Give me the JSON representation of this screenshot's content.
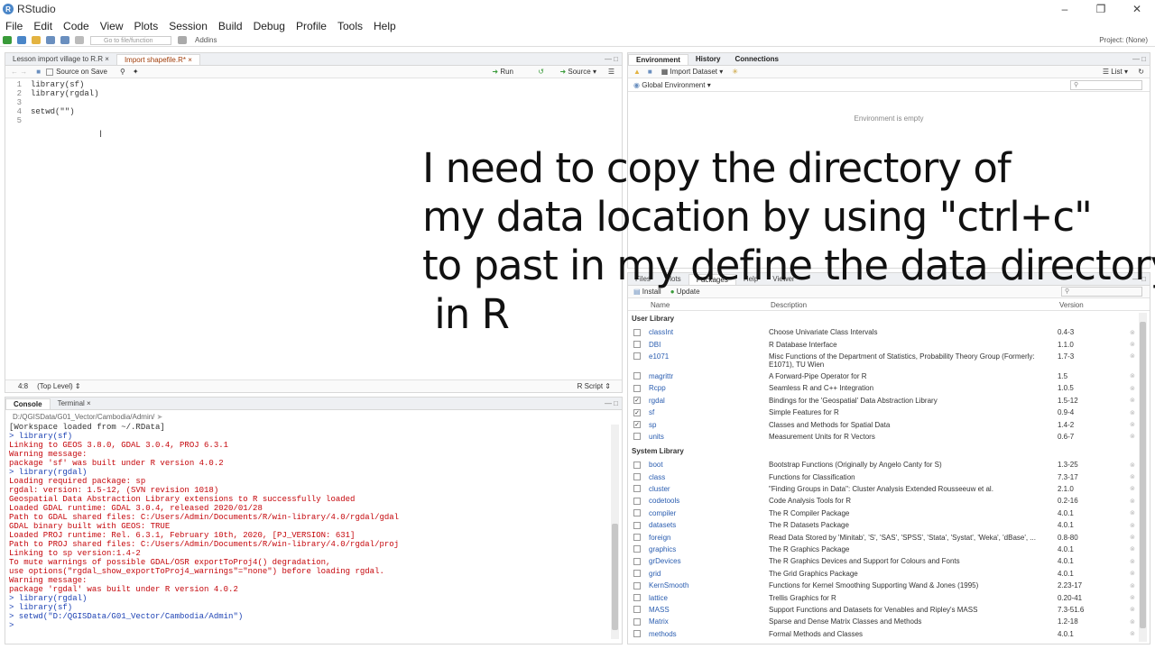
{
  "app": {
    "title": "RStudio",
    "logo": "R"
  },
  "menu": [
    "File",
    "Edit",
    "Code",
    "View",
    "Plots",
    "Session",
    "Build",
    "Debug",
    "Profile",
    "Tools",
    "Help"
  ],
  "toolbar": {
    "goto_placeholder": "Go to file/function",
    "addins": "Addins",
    "project": "Project: (None)"
  },
  "editor": {
    "tabs": [
      {
        "label": "Lesson import village to R.R"
      },
      {
        "label": "Import shapefile.R*"
      }
    ],
    "source_on_save": "Source on Save",
    "run": "Run",
    "source": "Source",
    "lines": [
      {
        "n": "1",
        "text": "library(sf)"
      },
      {
        "n": "2",
        "text": "library(rgdal)"
      },
      {
        "n": "3",
        "text": ""
      },
      {
        "n": "4",
        "text": "setwd(\"\")"
      },
      {
        "n": "5",
        "text": ""
      }
    ],
    "status_pos": "4:8",
    "status_scope": "(Top Level)",
    "status_type": "R Script"
  },
  "environment": {
    "tabs": [
      "Environment",
      "History",
      "Connections"
    ],
    "import_dataset": "Import Dataset",
    "list_view": "List",
    "global_env": "Global Environment",
    "empty_msg": "Environment is empty"
  },
  "console": {
    "tabs": [
      "Console",
      "Terminal"
    ],
    "path": "D:/QGISData/G01_Vector/Cambodia/Admin/",
    "lines": [
      {
        "c": "blk",
        "t": "[Workspace loaded from ~/.RData]"
      },
      {
        "c": "blk",
        "t": ""
      },
      {
        "c": "blue",
        "t": "> library(sf)"
      },
      {
        "c": "red",
        "t": "Linking to GEOS 3.8.0, GDAL 3.0.4, PROJ 6.3.1"
      },
      {
        "c": "red",
        "t": "Warning message:"
      },
      {
        "c": "red",
        "t": "package 'sf' was built under R version 4.0.2"
      },
      {
        "c": "blue",
        "t": "> library(rgdal)"
      },
      {
        "c": "red",
        "t": "Loading required package: sp"
      },
      {
        "c": "red",
        "t": "rgdal: version: 1.5-12, (SVN revision 1018)"
      },
      {
        "c": "red",
        "t": "Geospatial Data Abstraction Library extensions to R successfully loaded"
      },
      {
        "c": "red",
        "t": "Loaded GDAL runtime: GDAL 3.0.4, released 2020/01/28"
      },
      {
        "c": "red",
        "t": "Path to GDAL shared files: C:/Users/Admin/Documents/R/win-library/4.0/rgdal/gdal"
      },
      {
        "c": "red",
        "t": "GDAL binary built with GEOS: TRUE"
      },
      {
        "c": "red",
        "t": "Loaded PROJ runtime: Rel. 6.3.1, February 10th, 2020, [PJ_VERSION: 631]"
      },
      {
        "c": "red",
        "t": "Path to PROJ shared files: C:/Users/Admin/Documents/R/win-library/4.0/rgdal/proj"
      },
      {
        "c": "red",
        "t": "Linking to sp version:1.4-2"
      },
      {
        "c": "red",
        "t": "To mute warnings of possible GDAL/OSR exportToProj4() degradation,"
      },
      {
        "c": "red",
        "t": "use options(\"rgdal_show_exportToProj4_warnings\"=\"none\") before loading rgdal."
      },
      {
        "c": "red",
        "t": "Warning message:"
      },
      {
        "c": "red",
        "t": "package 'rgdal' was built under R version 4.0.2"
      },
      {
        "c": "blue",
        "t": "> library(rgdal)"
      },
      {
        "c": "blue",
        "t": "> library(sf)"
      },
      {
        "c": "blue",
        "t": "> setwd(\"D:/QGISData/G01_Vector/Cambodia/Admin\")"
      },
      {
        "c": "blue",
        "t": "> "
      }
    ]
  },
  "packages": {
    "tabs": [
      "Files",
      "Plots",
      "Packages",
      "Help",
      "Viewer"
    ],
    "install": "Install",
    "update": "Update",
    "headers": {
      "name": "Name",
      "desc": "Description",
      "version": "Version"
    },
    "user_label": "User Library",
    "system_label": "System Library",
    "user": [
      {
        "name": "classInt",
        "desc": "Choose Univariate Class Intervals",
        "ver": "0.4-3",
        "checked": false
      },
      {
        "name": "DBI",
        "desc": "R Database Interface",
        "ver": "1.1.0",
        "checked": false
      },
      {
        "name": "e1071",
        "desc": "Misc Functions of the Department of Statistics, Probability Theory Group (Formerly: E1071), TU Wien",
        "ver": "1.7-3",
        "checked": false
      },
      {
        "name": "magrittr",
        "desc": "A Forward-Pipe Operator for R",
        "ver": "1.5",
        "checked": false
      },
      {
        "name": "Rcpp",
        "desc": "Seamless R and C++ Integration",
        "ver": "1.0.5",
        "checked": false
      },
      {
        "name": "rgdal",
        "desc": "Bindings for the 'Geospatial' Data Abstraction Library",
        "ver": "1.5-12",
        "checked": true
      },
      {
        "name": "sf",
        "desc": "Simple Features for R",
        "ver": "0.9-4",
        "checked": true
      },
      {
        "name": "sp",
        "desc": "Classes and Methods for Spatial Data",
        "ver": "1.4-2",
        "checked": true
      },
      {
        "name": "units",
        "desc": "Measurement Units for R Vectors",
        "ver": "0.6-7",
        "checked": false
      }
    ],
    "system": [
      {
        "name": "boot",
        "desc": "Bootstrap Functions (Originally by Angelo Canty for S)",
        "ver": "1.3-25"
      },
      {
        "name": "class",
        "desc": "Functions for Classification",
        "ver": "7.3-17"
      },
      {
        "name": "cluster",
        "desc": "\"Finding Groups in Data\": Cluster Analysis Extended Rousseeuw et al.",
        "ver": "2.1.0"
      },
      {
        "name": "codetools",
        "desc": "Code Analysis Tools for R",
        "ver": "0.2-16"
      },
      {
        "name": "compiler",
        "desc": "The R Compiler Package",
        "ver": "4.0.1"
      },
      {
        "name": "datasets",
        "desc": "The R Datasets Package",
        "ver": "4.0.1"
      },
      {
        "name": "foreign",
        "desc": "Read Data Stored by 'Minitab', 'S', 'SAS', 'SPSS', 'Stata', 'Systat', 'Weka', 'dBase', ...",
        "ver": "0.8-80"
      },
      {
        "name": "graphics",
        "desc": "The R Graphics Package",
        "ver": "4.0.1"
      },
      {
        "name": "grDevices",
        "desc": "The R Graphics Devices and Support for Colours and Fonts",
        "ver": "4.0.1"
      },
      {
        "name": "grid",
        "desc": "The Grid Graphics Package",
        "ver": "4.0.1"
      },
      {
        "name": "KernSmooth",
        "desc": "Functions for Kernel Smoothing Supporting Wand & Jones (1995)",
        "ver": "2.23-17"
      },
      {
        "name": "lattice",
        "desc": "Trellis Graphics for R",
        "ver": "0.20-41"
      },
      {
        "name": "MASS",
        "desc": "Support Functions and Datasets for Venables and Ripley's MASS",
        "ver": "7.3-51.6"
      },
      {
        "name": "Matrix",
        "desc": "Sparse and Dense Matrix Classes and Methods",
        "ver": "1.2-18"
      },
      {
        "name": "methods",
        "desc": "Formal Methods and Classes",
        "ver": "4.0.1"
      }
    ]
  },
  "overlay_text": [
    "I need to copy the directory of",
    "my data location by using \"ctrl+c\"",
    "to past in my define the data directory",
    " in R"
  ]
}
